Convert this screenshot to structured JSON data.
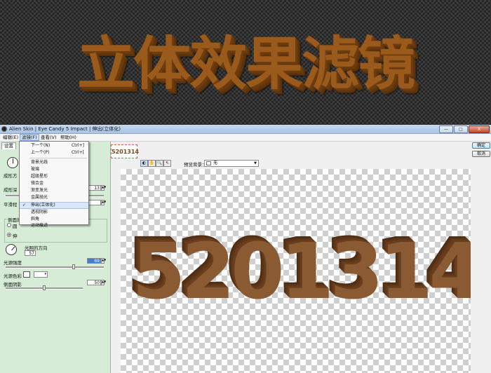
{
  "banner": {
    "title": "立体效果滤镜"
  },
  "window": {
    "title": "Alien Skin | Eye Candy 5 Impact | 伸出(立体化)",
    "controls": {
      "minimize": "—",
      "maximize": "□",
      "close": "X"
    }
  },
  "menubar": {
    "items": [
      {
        "label": "编辑(E)"
      },
      {
        "label": "滤镜(F)"
      },
      {
        "label": "查看(V)"
      },
      {
        "label": "帮助(H)"
      }
    ]
  },
  "dropdown": {
    "prev": {
      "label": "下一个(N)",
      "shortcut": "Ctrl+]"
    },
    "next": {
      "label": "上一个(P)",
      "shortcut": "Ctrl+["
    },
    "filters": [
      {
        "label": "背景光线"
      },
      {
        "label": "玻璃"
      },
      {
        "label": "超级星形"
      },
      {
        "label": "铬合金"
      },
      {
        "label": "渐变发光"
      },
      {
        "label": "金属抛光"
      },
      {
        "label": "伸出(立体化)",
        "checked": true
      },
      {
        "label": "透视阴影"
      },
      {
        "label": "斜角"
      },
      {
        "label": "运动痕迹"
      }
    ],
    "check_mark": "✓"
  },
  "left_panel": {
    "tab": "设置",
    "extrude_dir_label": "成形方",
    "extrude_dist_label": "成形深",
    "extrude_dist_value": "13",
    "smooth_label": "平滑程",
    "bevel_group_label": "侧面的",
    "radio_a": "圆",
    "radio_b": "伸",
    "light_dir_label": "光照的方向",
    "light_dir_value": "57",
    "light_intensity_label": "光源强度",
    "light_intensity_value": "69",
    "light_intensity_level": 0.69,
    "light_color_label": "光源色彩",
    "side_shadow_label": "侧面阴影",
    "side_shadow_value": "50",
    "side_shadow_level": 0.5,
    "light_color": "#ffffff",
    "accent_color": "#3b7fd6"
  },
  "preview": {
    "thumbnail_text": "5201314",
    "bg_label": "预览背景：",
    "bg_value": "无",
    "preview_text": "5201314",
    "text_color": "#8a5a33"
  },
  "toolbar": {
    "tools": [
      {
        "icon": "preview-toggle-icon",
        "glyph": "◐"
      },
      {
        "icon": "hand-icon",
        "glyph": "✋"
      },
      {
        "icon": "zoom-icon",
        "glyph": "🔍"
      },
      {
        "icon": "pointer-icon",
        "glyph": "↖"
      }
    ]
  },
  "right_panel": {
    "ok_label": "确定",
    "cancel_label": "取消"
  }
}
